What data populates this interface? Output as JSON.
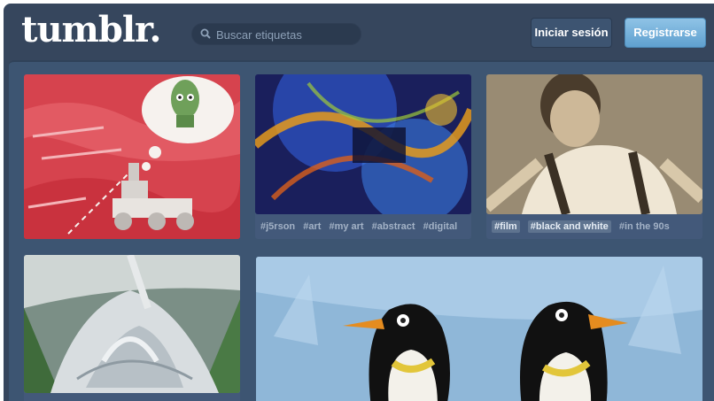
{
  "header": {
    "logo": "tumblr.",
    "search_placeholder": "Buscar etiquetas",
    "login_label": "Iniciar sesión",
    "register_label": "Registrarse"
  },
  "posts": [
    {
      "tags": []
    },
    {
      "tags": [
        "#j5rson",
        "#art",
        "#my art",
        "#abstract",
        "#digital"
      ]
    },
    {
      "tags": [
        "#film",
        "#black and white",
        "#in the 90s"
      ]
    },
    {
      "tags": []
    },
    {
      "tags": []
    }
  ],
  "colors": {
    "background": "#36465d",
    "accent": "#5fa0cf"
  }
}
